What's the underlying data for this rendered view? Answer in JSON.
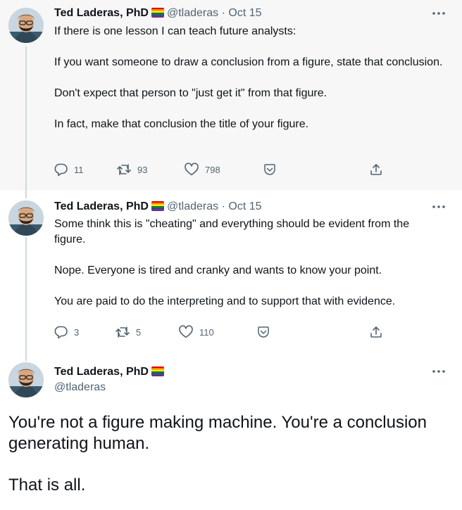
{
  "author": {
    "name": "Ted Laderas, PhD",
    "handle": "@tladeras",
    "flag_colors": [
      "#e40303",
      "#ff8c00",
      "#ffed00",
      "#008026",
      "#24408e",
      "#732982"
    ]
  },
  "tweets": [
    {
      "date": "Oct 15",
      "separator": "·",
      "paragraphs": [
        "If there is one lesson I can teach future analysts:",
        "If you want someone to draw a conclusion from a figure, state that conclusion.",
        "Don't expect that person to \"just get it\" from that figure.",
        "In fact, make that conclusion the title of your figure."
      ],
      "replies": "11",
      "retweets": "93",
      "likes": "798"
    },
    {
      "date": "Oct 15",
      "separator": "·",
      "paragraphs": [
        "Some think this is \"cheating\" and everything should be evident from the figure.",
        "Nope. Everyone is tired and cranky and wants to know your point.",
        "You are paid to do the interpreting and to support that with evidence."
      ],
      "replies": "3",
      "retweets": "5",
      "likes": "110"
    },
    {
      "paragraphs": [
        "You're not a figure making machine. You're a conclusion generating human.",
        "That is all."
      ]
    }
  ],
  "icons": {
    "more": "more-icon",
    "reply": "reply-icon",
    "retweet": "retweet-icon",
    "like": "heart-icon",
    "save": "save-icon",
    "share": "share-icon"
  },
  "colors": {
    "text": "#0f1419",
    "secondary": "#536471",
    "thread_line": "#cfd9de",
    "highlight_bg": "#f7f7f7"
  }
}
